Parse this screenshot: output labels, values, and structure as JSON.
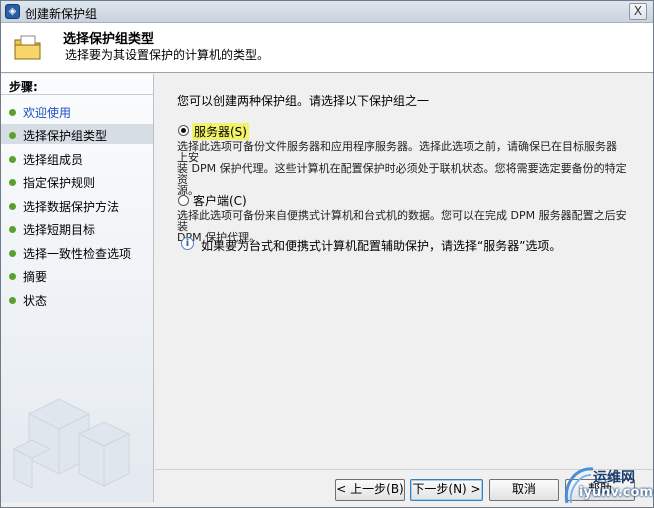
{
  "window": {
    "title": "创建新保护组",
    "close_glyph": "X"
  },
  "header": {
    "title": "选择保护组类型",
    "subtitle": "选择要为其设置保护的计算机的类型。",
    "icon": "folder-icon"
  },
  "sidebar": {
    "heading": "步骤:",
    "items": [
      {
        "label": "欢迎使用",
        "state": "link"
      },
      {
        "label": "选择保护组类型",
        "state": "active"
      },
      {
        "label": "选择组成员",
        "state": "normal"
      },
      {
        "label": "指定保护规则",
        "state": "normal"
      },
      {
        "label": "选择数据保护方法",
        "state": "normal"
      },
      {
        "label": "选择短期目标",
        "state": "normal"
      },
      {
        "label": "选择一致性检查选项",
        "state": "normal"
      },
      {
        "label": "摘要",
        "state": "normal"
      },
      {
        "label": "状态",
        "state": "normal"
      }
    ]
  },
  "main": {
    "intro": "您可以创建两种保护组。请选择以下保护组之一",
    "options": [
      {
        "label": "服务器(S)",
        "selected": true,
        "desc_line1": "选择此选项可备份文件服务器和应用程序服务器。选择此选项之前，请确保已在目标服务器上安",
        "desc_line2": "装 DPM 保护代理。这些计算机在配置保护时必须处于联机状态。您将需要选定要备份的特定资",
        "desc_line3": "源。"
      },
      {
        "label": "客户端(C)",
        "selected": false,
        "desc_line1": "选择此选项可备份来自便携式计算机和台式机的数据。您可以在完成 DPM 服务器配置之后安装",
        "desc_line2": "DPM 保护代理。"
      }
    ],
    "info": "如果要为台式和便携式计算机配置辅助保护，请选择“服务器”选项。"
  },
  "footer": {
    "back": "< 上一步(B)",
    "next": "下一步(N) >",
    "cancel": "取消",
    "help": "帮助"
  },
  "watermark": {
    "line1": "运维网",
    "line2": "iyunv.com"
  },
  "colors": {
    "link": "#1d4fc4",
    "step_dot": "#5aa02c",
    "highlight": "#f3f36a"
  }
}
